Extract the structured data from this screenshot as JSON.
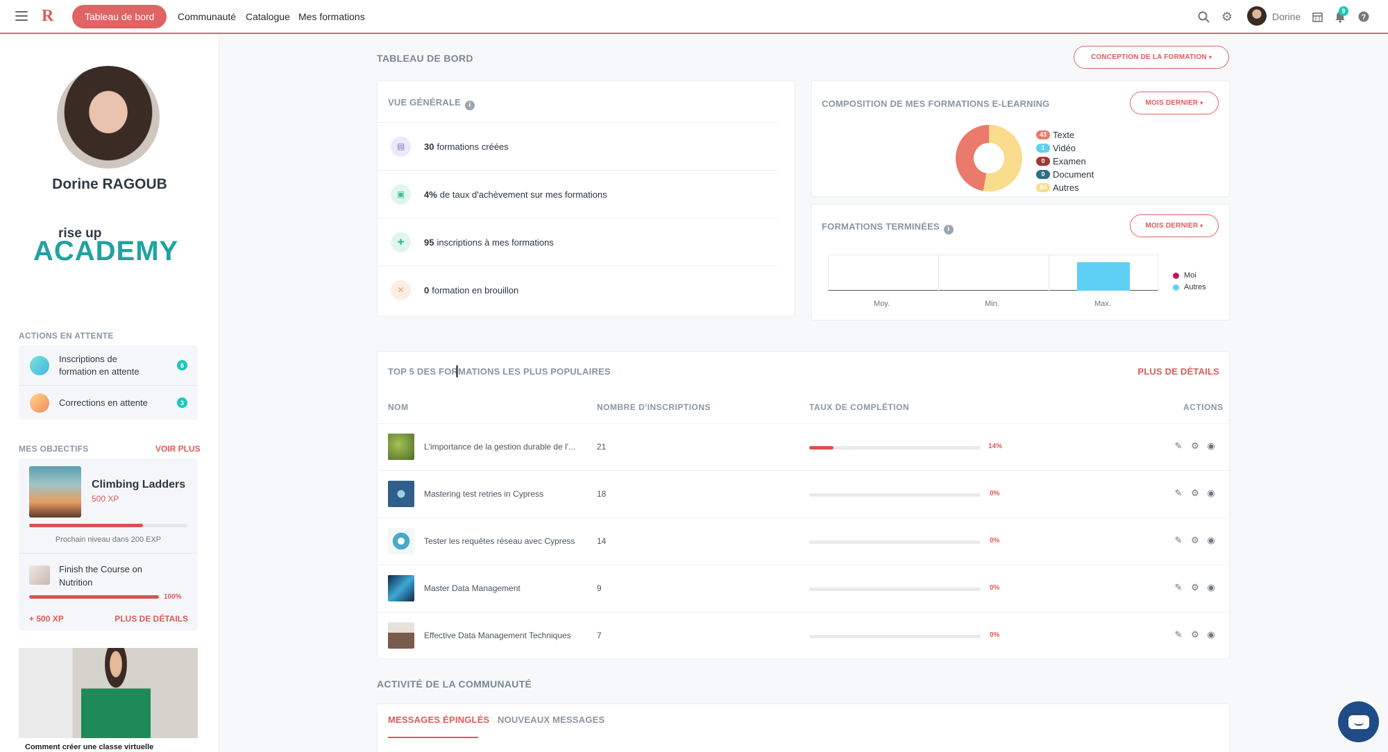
{
  "nav": {
    "active": "Tableau de bord",
    "links": [
      "Communauté",
      "Catalogue",
      "Mes formations"
    ],
    "user": "Dorine",
    "notification_count": "9"
  },
  "profile": {
    "name": "Dorine RAGOUB"
  },
  "brand": {
    "logo_top": "rise up",
    "logo_main": "ACADEMY"
  },
  "pending": {
    "title": "ACTIONS EN ATTENTE",
    "items": [
      {
        "label": "Inscriptions de formation en attente",
        "count": "6"
      },
      {
        "label": "Corrections en attente",
        "count": "3"
      }
    ]
  },
  "objectives": {
    "title": "MES OBJECTIFS",
    "see_more": "VOIR PLUS",
    "main_goal": {
      "title": "Climbing Ladders",
      "xp": "500 XP",
      "progress": 0.72,
      "next_level": "Prochain niveau dans 200 EXP"
    },
    "sub_goal": {
      "title": "Finish the Course on Nutrition",
      "progress_label": "100%",
      "progress": 1.0
    },
    "bonus": "+ 500 XP",
    "details": "PLUS DE DÉTAILS"
  },
  "video": {
    "caption": "Comment créer une classe virtuelle"
  },
  "dashboard": {
    "title": "TABLEAU DE BORD",
    "design_button": "CONCEPTION DE LA FORMATION",
    "overview": {
      "title": "VUE GÉNÉRALE",
      "rows": [
        {
          "value": "30",
          "text": "formations créées"
        },
        {
          "value": "4%",
          "text": "de taux d'achèvement sur mes formations"
        },
        {
          "value": "95",
          "text": "inscriptions à mes formations"
        },
        {
          "value": "0",
          "text": "formation en brouillon"
        }
      ]
    },
    "composition": {
      "title": "COMPOSITION DE MES FORMATIONS E-LEARNING",
      "period": "MOIS DERNIER",
      "legend": [
        {
          "count": "43",
          "label": "Texte",
          "color": "#ea7a6b"
        },
        {
          "count": "1",
          "label": "Vidéo",
          "color": "#5fd0f5"
        },
        {
          "count": "0",
          "label": "Examen",
          "color": "#9b3b32"
        },
        {
          "count": "0",
          "label": "Document",
          "color": "#2e6f80"
        },
        {
          "count": "84",
          "label": "Autres",
          "color": "#f9dc8c"
        }
      ]
    },
    "completed": {
      "title": "FORMATIONS TERMINÉES",
      "period": "MOIS DERNIER",
      "axis": [
        "Moy.",
        "Min.",
        "Max."
      ],
      "legend": [
        {
          "label": "Moi",
          "color": "#c2185b"
        },
        {
          "label": "Autres",
          "color": "#5fd0f5"
        }
      ]
    },
    "top5": {
      "title": "TOP 5 DES FORMATIONS LES PLUS POPULAIRES",
      "details": "PLUS DE DÉTAILS",
      "columns": [
        "NOM",
        "NOMBRE D'INSCRIPTIONS",
        "TAUX DE COMPLÉTION",
        "ACTIONS"
      ],
      "rows": [
        {
          "name": "L'importance de la gestion durable de l'...",
          "count": "21",
          "pct": "14%",
          "progress": 0.14
        },
        {
          "name": "Mastering test retries in Cypress",
          "count": "18",
          "pct": "0%",
          "progress": 0
        },
        {
          "name": "Tester les requêtes réseau avec Cypress",
          "count": "14",
          "pct": "0%",
          "progress": 0
        },
        {
          "name": "Master Data Management",
          "count": "9",
          "pct": "0%",
          "progress": 0
        },
        {
          "name": "Effective Data Management Techniques",
          "count": "7",
          "pct": "0%",
          "progress": 0
        }
      ]
    },
    "community": {
      "title": "ACTIVITÉ DE LA COMMUNAUTÉ",
      "tabs": [
        "MESSAGES ÉPINGLÉS",
        "NOUVEAUX MESSAGES"
      ]
    }
  }
}
